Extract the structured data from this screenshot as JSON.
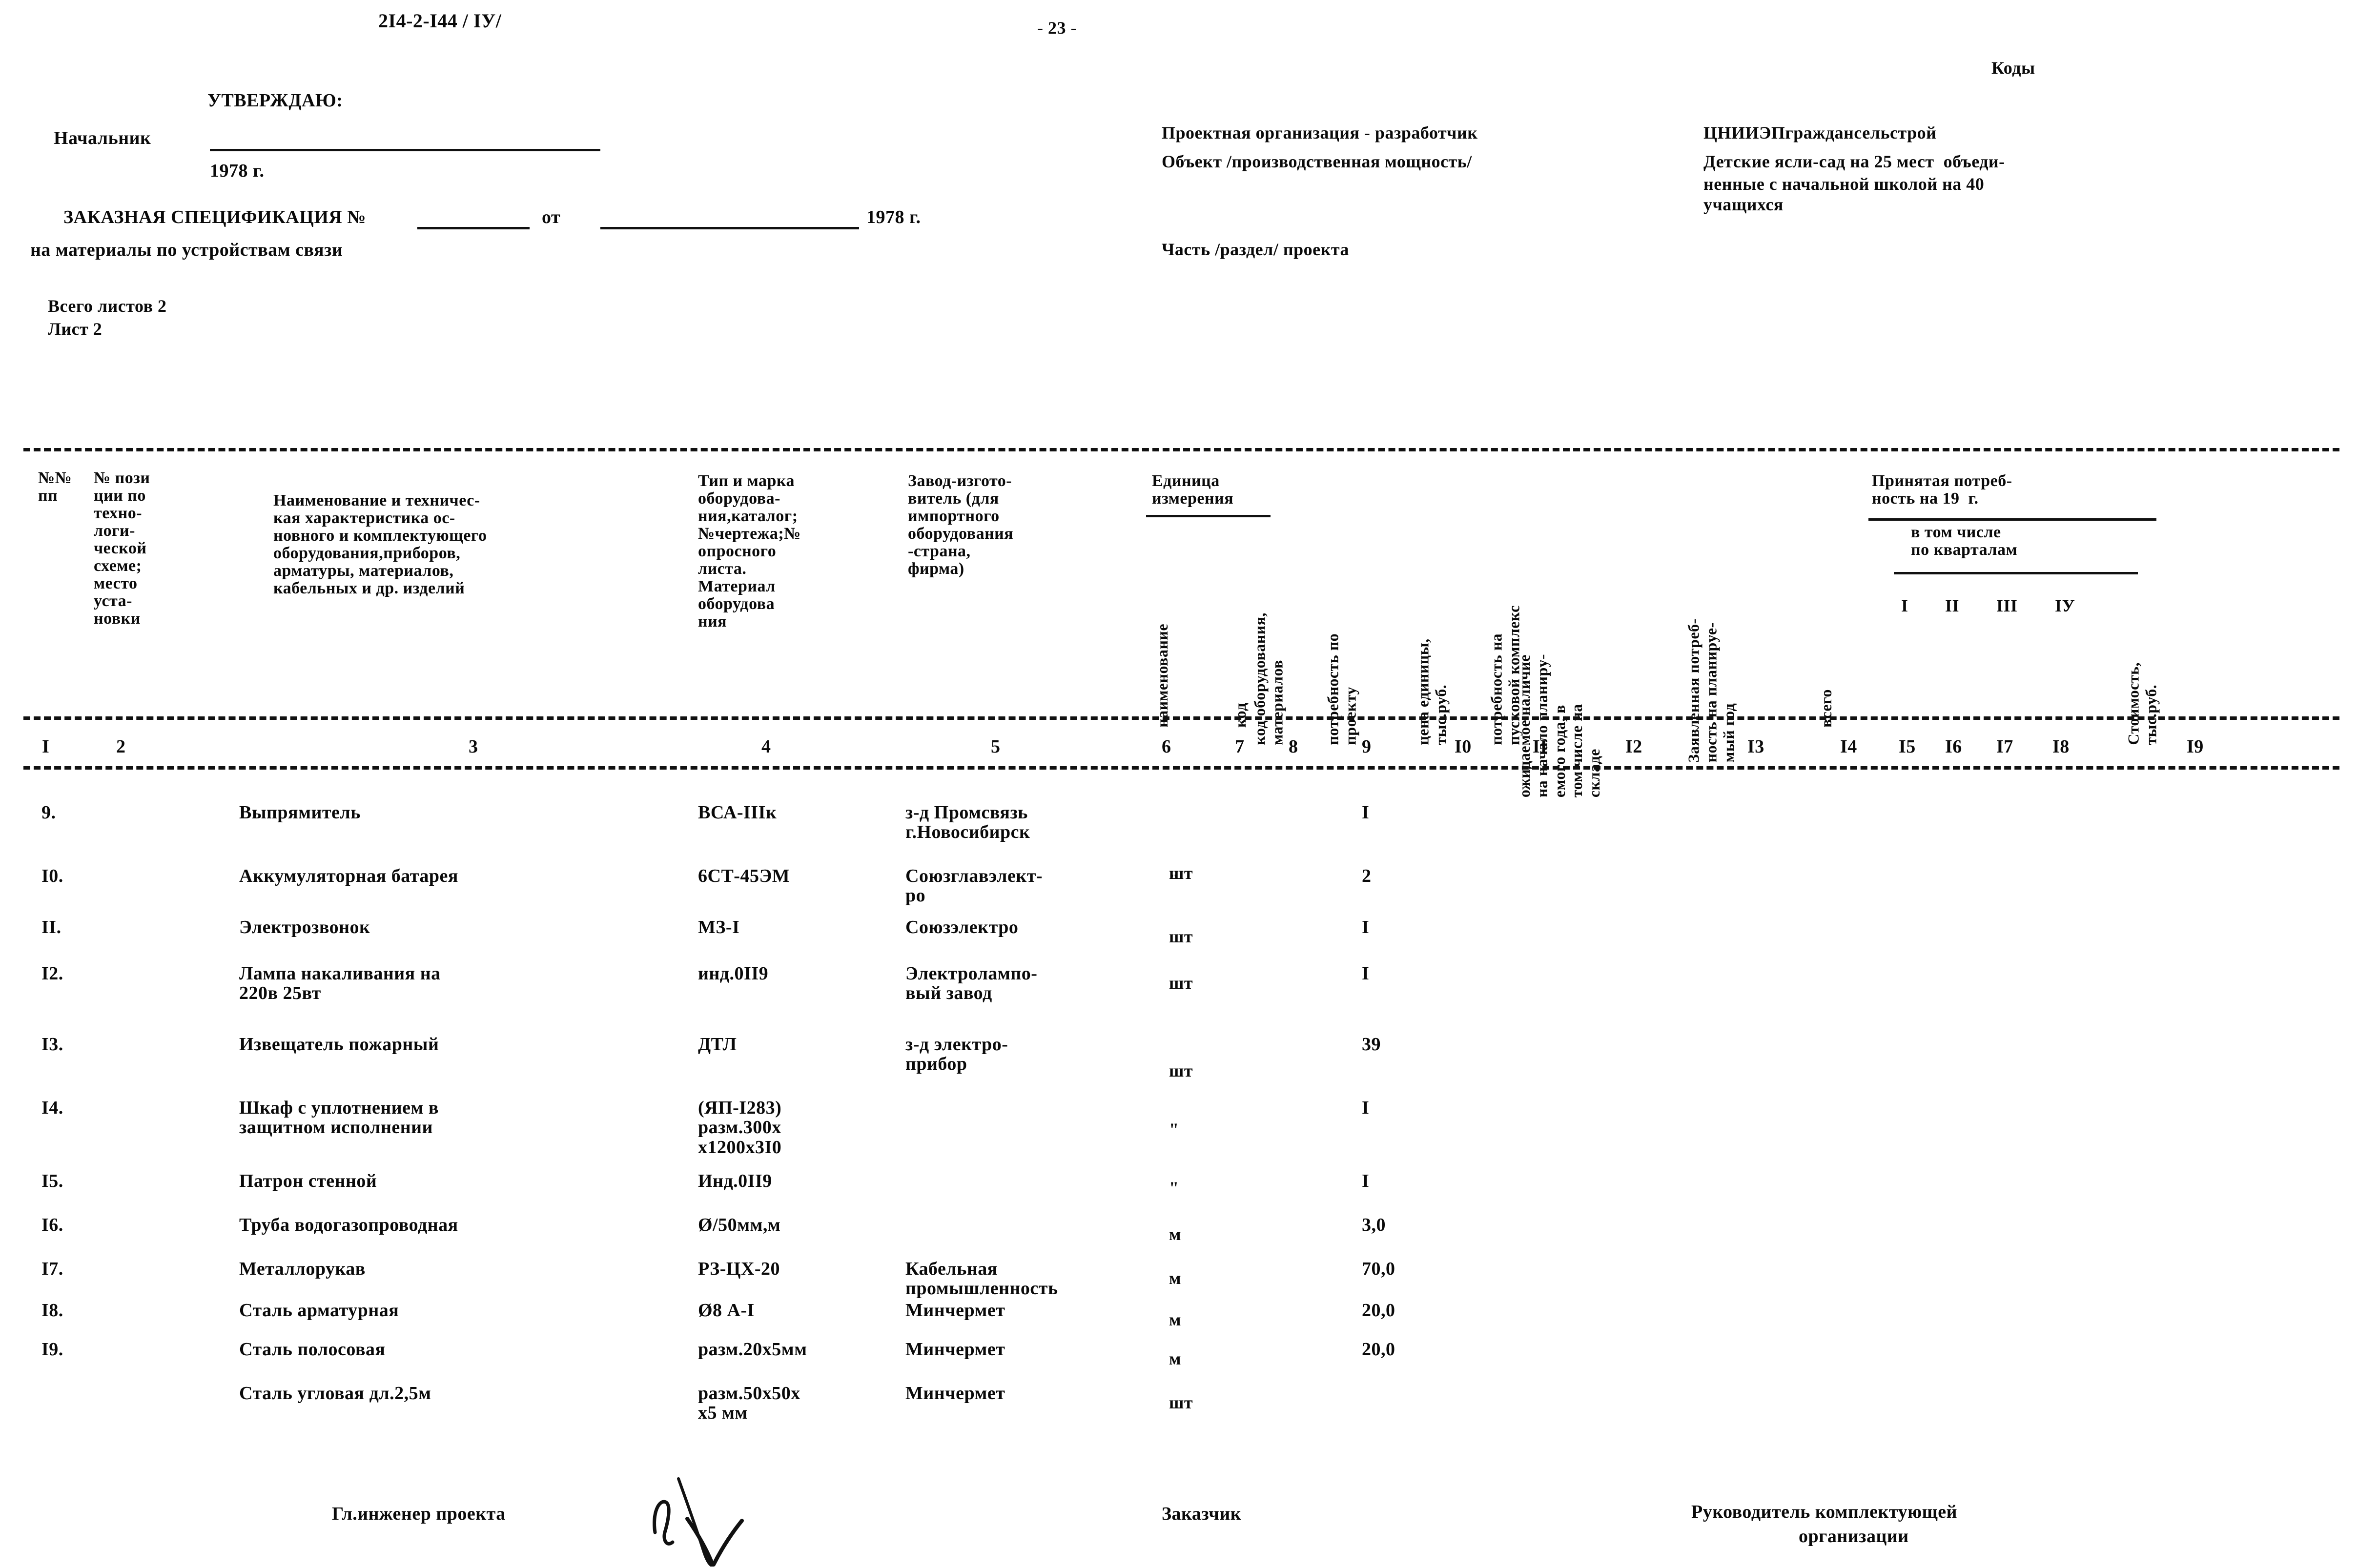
{
  "page": {
    "doc_number": "2I4-2-I44 / IУ/",
    "page_label": "- 23 -",
    "codes_label": "Коды"
  },
  "approval_block": {
    "approve_label": "УТВЕРЖДАЮ:",
    "chief_label": "Начальник",
    "year_label": "1978 г."
  },
  "spec_block": {
    "title_prefix": "ЗАКАЗНАЯ СПЕЦИФИКАЦИЯ №",
    "from_label": "от",
    "year_label": "1978 г.",
    "subtitle": "на материалы по устройствам связи",
    "sheets_total": "Всего листов 2",
    "sheet_number": "Лист 2"
  },
  "org_block": {
    "designer_label": "Проектная организация - разработчик",
    "designer_value": "ЦНИИЭПграждансельстрой",
    "object_label": "Объект /производственная мощность/",
    "object_value_line1": "Детские ясли-сад на 25 мест  объеди-",
    "object_value_line2": "ненные с начальной школой на 40",
    "object_value_line3": "учащихся",
    "part_label": "Часть /раздел/ проекта"
  },
  "table": {
    "headers": {
      "c1": "№№\nпп",
      "c2": "№ пози\nции по\nтехно-\nлоги-\nческой\nсхеме;\nместо\nуста-\nновки",
      "c3": "Наименование и техничес-\nкая характеристика ос-\nновного и комплектующего\nоборудования,приборов,\nарматуры, материалов,\nкабельных и др. изделий",
      "c4": "Тип и марка\nоборудова-\nния,каталог;\n№чертежа;№\nопросного\nлиста.\nМатериал\nоборудова\nния",
      "c5": "Завод-изгото-\nвитель (для\nимпортного\nоборудования\n-страна,\nфирма)",
      "c6_group": "Единица\nизмерения",
      "c6": "наименование",
      "c7": "код",
      "c8": "код оборудования,\nматериалов",
      "c9": "потребность по\nпроекту",
      "c10": "цена единицы,\nтыс.руб.",
      "c11": "потребность на\nпусковой комплекс",
      "c12": "ожидаемое наличие\nна начало планиру-\nемого года, в\nтом числе на\nскладе",
      "c13": "Заявленная потреб-\nность на планируе-\nмый год",
      "c14": "всего",
      "c_accepted_group": "Принятая потреб-\nность на 19  г.",
      "c_accepted_sub": "в том числе\nпо кварталам",
      "c15": "I",
      "c16": "II",
      "c17": "III",
      "c18": "IУ",
      "c19": "Стоимость,\nтыс.руб."
    },
    "column_numbers": [
      "I",
      "2",
      "3",
      "4",
      "5",
      "6",
      "7",
      "8",
      "9",
      "I0",
      "II",
      "I2",
      "I3",
      "I4",
      "I5",
      "I6",
      "I7",
      "I8",
      "I9"
    ],
    "rows": [
      {
        "no": "9.",
        "name": "Выпрямитель",
        "type": "ВСА-IIIк",
        "maker": "з-д Промсвязь\nг.Новосибирск",
        "unit": "шт",
        "qty": "I"
      },
      {
        "no": "I0.",
        "name": "Аккумуляторная батарея",
        "type": "6СТ-45ЭМ",
        "maker": "Союзглавэлект-\nро",
        "unit": "\"",
        "qty": "2"
      },
      {
        "no": "II.",
        "name": "Электрозвонок",
        "type": "МЗ-I",
        "maker": "Союзэлектро",
        "unit": "шт",
        "qty": "I"
      },
      {
        "no": "I2.",
        "name": "Лампа накаливания на\n220в 25вт",
        "type": "инд.0II9",
        "maker": "Электролампо-\nвый завод",
        "unit": "шт",
        "qty": "I"
      },
      {
        "no": "I3.",
        "name": "Извещатель пожарный",
        "type": "ДТЛ",
        "maker": "з-д электро-\nприбор",
        "unit": "шт",
        "qty": "39"
      },
      {
        "no": "I4.",
        "name": "Шкаф с уплотнением в\nзащитном исполнении",
        "type": "(ЯП-I283)\nразм.300х\nх1200х3I0",
        "maker": "",
        "unit": "\"",
        "qty": "I"
      },
      {
        "no": "I5.",
        "name": "Патрон стенной",
        "type": "Инд.0II9",
        "maker": "",
        "unit": "\"",
        "qty": "I"
      },
      {
        "no": "I6.",
        "name": "Труба водогазопроводная",
        "type": "Ø/50мм,м",
        "maker": "",
        "unit": "м",
        "qty": "3,0"
      },
      {
        "no": "I7.",
        "name": "Металлорукав",
        "type": "РЗ-ЦХ-20",
        "maker": "Кабельная\nпромышленность",
        "unit": "м",
        "qty": "70,0"
      },
      {
        "no": "I8.",
        "name": "Сталь арматурная",
        "type": "Ø8 А-I",
        "maker": "Минчермет",
        "unit": "м",
        "qty": "20,0"
      },
      {
        "no": "I9.",
        "name": "Сталь полосовая",
        "type": "разм.20х5мм",
        "maker": "Минчермет",
        "unit": "м",
        "qty": "20,0"
      },
      {
        "no": "",
        "name": "Сталь угловая дл.2,5м",
        "type": "разм.50х50х\nх5 мм",
        "maker": "Минчермет",
        "unit": "шт",
        "qty": ""
      }
    ]
  },
  "footer": {
    "chief_engineer": "Гл.инженер проекта",
    "customer": "Заказчик",
    "supplier_line1": "Руководитель комплектующей",
    "supplier_line2": "организации"
  }
}
